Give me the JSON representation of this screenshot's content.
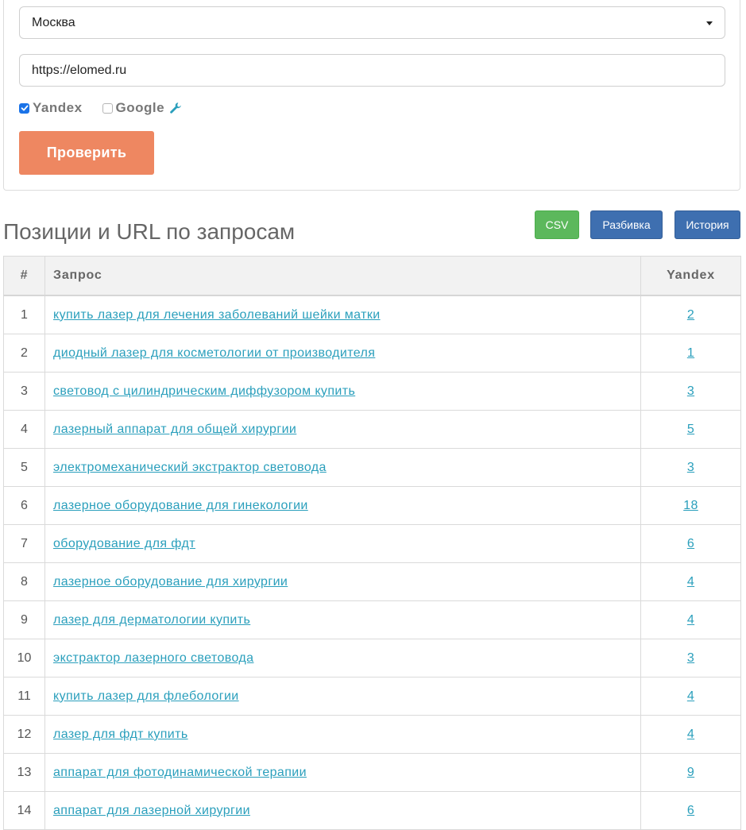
{
  "form": {
    "region_value": "Москва",
    "url_value": "https://elomed.ru",
    "engines": [
      {
        "label": "Yandex",
        "checked": true
      },
      {
        "label": "Google",
        "checked": false
      }
    ],
    "submit_label": "Проверить"
  },
  "results": {
    "title": "Позиции и URL по запросам",
    "buttons": {
      "csv": "CSV",
      "split": "Разбивка",
      "history": "История"
    },
    "columns": {
      "num": "#",
      "query": "Запрос",
      "yandex": "Yandex"
    },
    "rows": [
      {
        "n": "1",
        "query": "купить лазер для лечения заболеваний шейки матки",
        "yandex": "2"
      },
      {
        "n": "2",
        "query": "диодный лазер для косметологии от производителя",
        "yandex": "1"
      },
      {
        "n": "3",
        "query": "световод с цилиндрическим диффузором купить",
        "yandex": "3"
      },
      {
        "n": "4",
        "query": "лазерный аппарат для общей хирургии",
        "yandex": "5"
      },
      {
        "n": "5",
        "query": "электромеханический экстрактор световода",
        "yandex": "3"
      },
      {
        "n": "6",
        "query": "лазерное оборудование для гинекологии",
        "yandex": "18"
      },
      {
        "n": "7",
        "query": "оборудование для фдт",
        "yandex": "6"
      },
      {
        "n": "8",
        "query": "лазерное оборудование для хирургии",
        "yandex": "4"
      },
      {
        "n": "9",
        "query": "лазер для дерматологии купить",
        "yandex": "4"
      },
      {
        "n": "10",
        "query": "экстрактор лазерного световода",
        "yandex": "3"
      },
      {
        "n": "11",
        "query": "купить лазер для флебологии",
        "yandex": "4"
      },
      {
        "n": "12",
        "query": "лазер для фдт купить",
        "yandex": "4"
      },
      {
        "n": "13",
        "query": "аппарат для фотодинамической терапии",
        "yandex": "9"
      },
      {
        "n": "14",
        "query": "аппарат для лазерной хирургии",
        "yandex": "6"
      }
    ]
  },
  "colors": {
    "accent_orange": "#ee8761",
    "csv_green": "#5cb85c",
    "primary_blue": "#3e6fb0",
    "link_teal": "#2a9fbc",
    "checkbox_blue": "#1a73e8"
  }
}
